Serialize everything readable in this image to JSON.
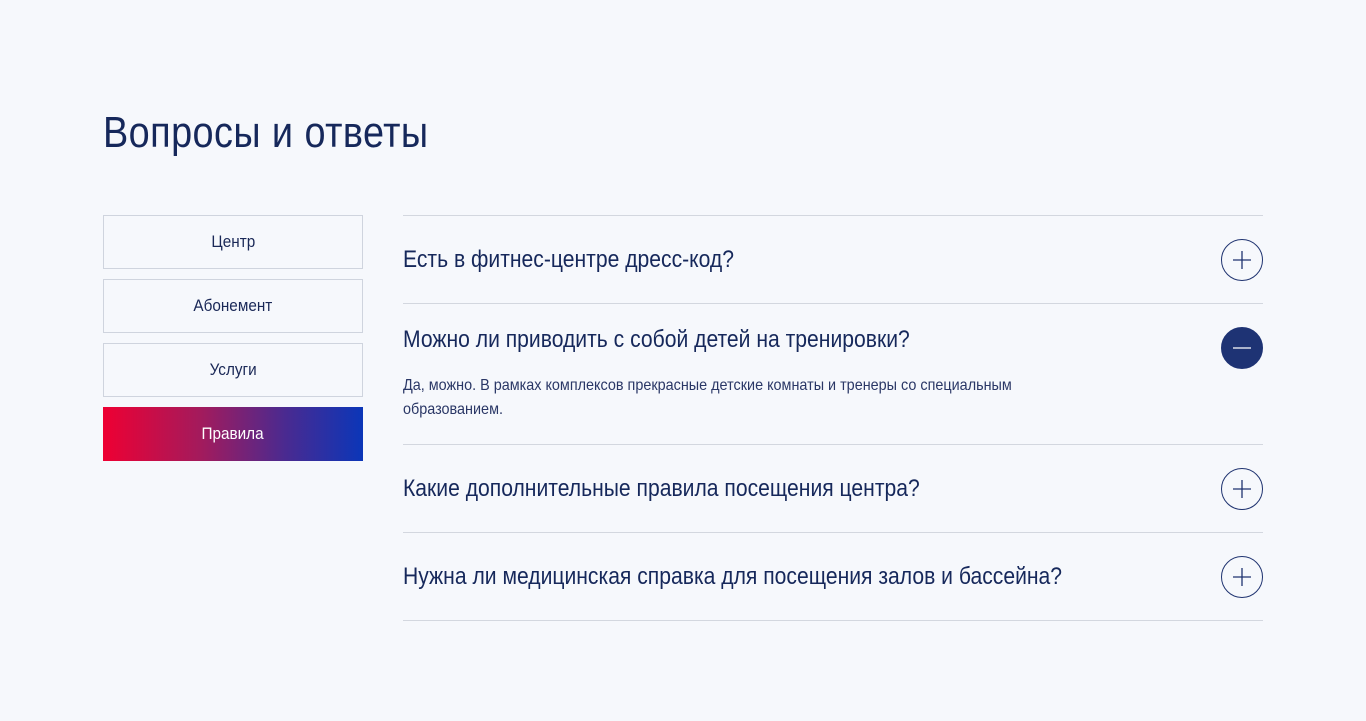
{
  "page": {
    "title": "Вопросы и ответы"
  },
  "sidebar": {
    "items": [
      {
        "label": "Центр",
        "active": false
      },
      {
        "label": "Абонемент",
        "active": false
      },
      {
        "label": "Услуги",
        "active": false
      },
      {
        "label": "Правила",
        "active": true
      }
    ]
  },
  "faq": {
    "items": [
      {
        "question": "Есть в фитнес-центре дресс-код?",
        "expanded": false,
        "toggle_icon": "plus-icon"
      },
      {
        "question": "Можно ли приводить с собой детей на тренировки?",
        "expanded": true,
        "toggle_icon": "minus-icon",
        "answer": "Да, можно. В рамках комплексов прекрасные детские комнаты и тренеры со специальным образованием."
      },
      {
        "question": "Какие дополнительные правила посещения центра?",
        "expanded": false,
        "toggle_icon": "plus-icon"
      },
      {
        "question": "Нужна ли медицинская справка для посещения залов и бассейна?",
        "expanded": false,
        "toggle_icon": "plus-icon"
      }
    ]
  },
  "colors": {
    "text": "#16285b",
    "accent": "#1e3374",
    "gradient_start": "#ee0033",
    "gradient_end": "#0b36b8",
    "background": "#f6f8fc"
  }
}
